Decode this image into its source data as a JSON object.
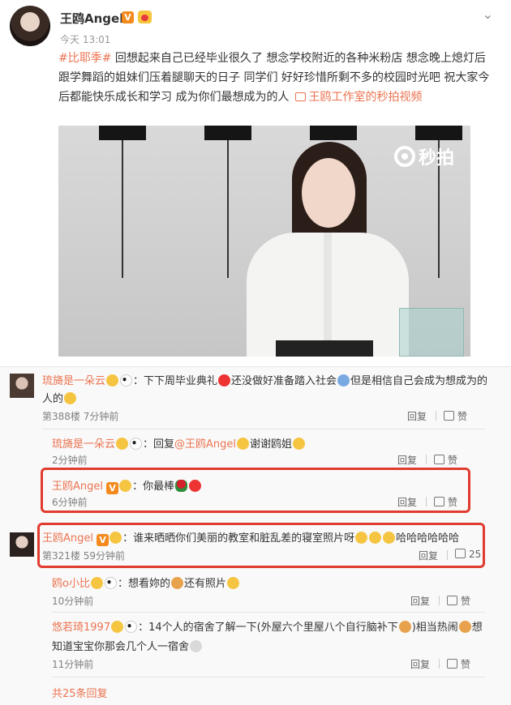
{
  "post": {
    "username": "王鸥Angel",
    "verified_badge": "V",
    "time": "今天 13:01",
    "topic": "#比耶季#",
    "text": " 回想起来自己已经毕业很久了 想念学校附近的各种米粉店 想念晚上熄灯后跟学舞蹈的姐妹们压着腿聊天的日子 同学们 好好珍惜所剩不多的校园时光吧 祝大家今后都能快乐成长和学习 成为你们最想成为的人",
    "video_link": "王鸥工作室的秒拍视频",
    "video_watermark": "秒拍",
    "menu_icon": "chevron-down-icon"
  },
  "comments": [
    {
      "user": "琉旖是一朵云",
      "text_a": "：下下周毕业典礼",
      "text_b": "还没做好准备踏入社会",
      "text_c": "但是相信自己会成为想成为的",
      "text_d": "人的",
      "meta": "第388楼 7分钟前",
      "reply": "回复",
      "like": "赞"
    },
    {
      "user": "琉旖是一朵云",
      "prefix": "：回复",
      "mention": "@王鸥Angel",
      "text": "谢谢鸥姐",
      "meta": "2分钟前",
      "reply": "回复",
      "like": "赞"
    },
    {
      "user": "王鸥Angel",
      "badge": "V",
      "text": "：你最棒",
      "meta": "6分钟前",
      "reply": "回复",
      "like": "赞"
    },
    {
      "user": "王鸥Angel",
      "badge": "V",
      "text": "：谁来晒晒你们美丽的教室和脏乱差的寝室照片呀",
      "text_end": "哈哈哈哈哈哈",
      "meta": "第321楼 59分钟前",
      "reply": "回复",
      "like": "25"
    },
    {
      "user": "鸥o小比",
      "text": "：想看妳的",
      "text_b": "还有照片",
      "meta": "10分钟前",
      "reply": "回复",
      "like": "赞"
    },
    {
      "user": "悠若琦1997",
      "text_a": "：14个人的宿舍了解一下(外屋六个里屋八个自行脑补下",
      "text_b": ")相当热闹",
      "text_c": "想",
      "text_d": "知道宝宝你那会几个人一宿舍",
      "meta": "11分钟前",
      "reply": "回复",
      "like": "赞"
    }
  ],
  "total_replies": "共25条回复",
  "colors": {
    "accent": "#eb7350",
    "highlight_box": "#e03b2e",
    "verified": "#f48a1d"
  }
}
